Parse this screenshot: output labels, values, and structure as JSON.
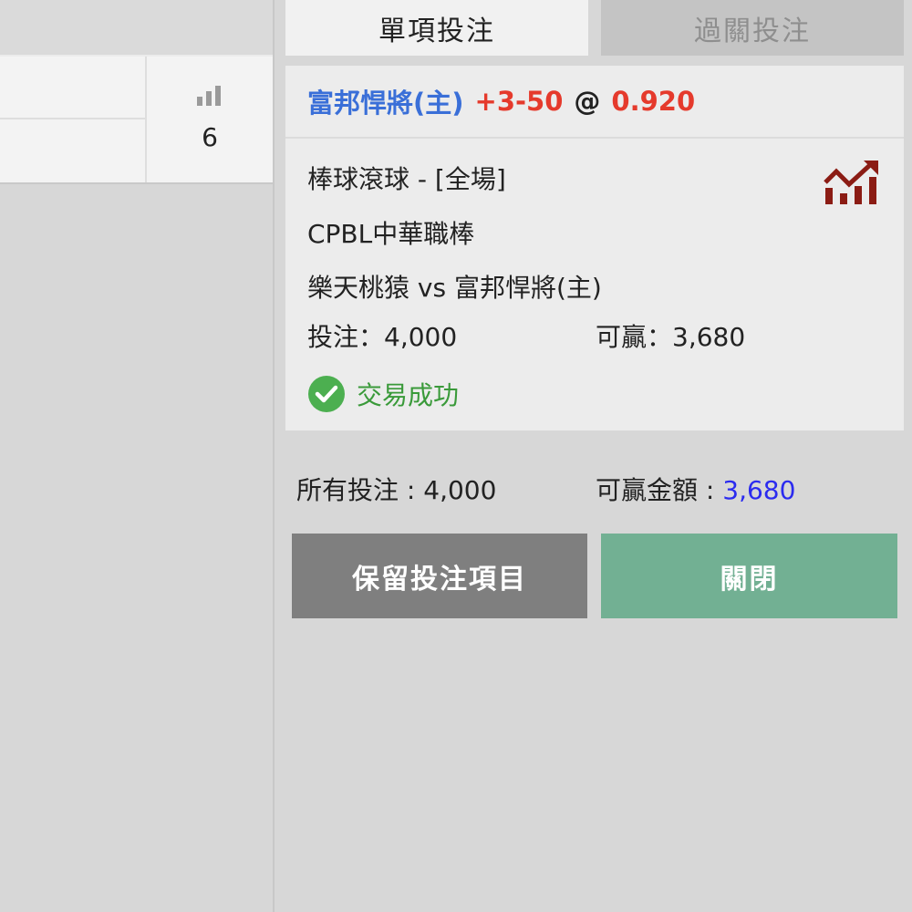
{
  "left": {
    "stat_count": "6",
    "stat_icon": "bar-chart-icon"
  },
  "tabs": {
    "single": "單項投注",
    "parlay": "過關投注"
  },
  "bet": {
    "selection": "富邦悍將(主)",
    "handicap": "+3-50",
    "at": "@",
    "odds": "0.920",
    "market": "棒球滾球 - [全場]",
    "league": "CPBL中華職棒",
    "match": "樂天桃猿 vs 富邦悍將(主)",
    "stake_label": "投注：",
    "stake": "4,000",
    "win_label": "可贏：",
    "win": "3,680",
    "status": "交易成功",
    "trend_icon": "trend-chart-icon",
    "status_icon": "check-circle-icon"
  },
  "totals": {
    "all_stake_label": "所有投注 : ",
    "all_stake": "4,000",
    "win_amount_label": "可贏金額 : ",
    "win_amount": "3,680"
  },
  "buttons": {
    "keep": "保留投注項目",
    "close": "關閉"
  },
  "colors": {
    "selection": "#3a6fd8",
    "odds": "#e53a2c",
    "success": "#3a9a3a",
    "win_amount": "#2b2bef",
    "keep_button": "#7f7f7f",
    "close_button": "#72b093"
  }
}
